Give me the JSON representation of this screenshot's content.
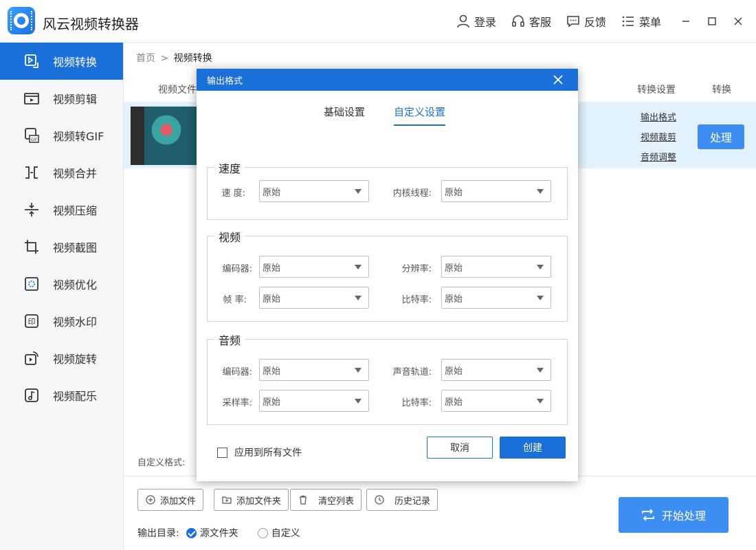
{
  "app": {
    "title": "风云视频转换器"
  },
  "header": {
    "login": "登录",
    "service": "客服",
    "feedback": "反馈",
    "menu": "菜单"
  },
  "sidebar": {
    "items": [
      {
        "label": "视频转换",
        "icon": "convert-icon"
      },
      {
        "label": "视频剪辑",
        "icon": "clip-icon"
      },
      {
        "label": "视频转GIF",
        "icon": "gif-icon"
      },
      {
        "label": "视频合并",
        "icon": "merge-icon"
      },
      {
        "label": "视频压缩",
        "icon": "compress-icon"
      },
      {
        "label": "视频截图",
        "icon": "screenshot-icon"
      },
      {
        "label": "视频优化",
        "icon": "optimize-icon"
      },
      {
        "label": "视频水印",
        "icon": "watermark-icon"
      },
      {
        "label": "视频旋转",
        "icon": "rotate-icon"
      },
      {
        "label": "视频配乐",
        "icon": "music-icon"
      }
    ]
  },
  "main": {
    "breadcrumb_home": "首页",
    "breadcrumb_sep": ">",
    "breadcrumb_current": "视频转换",
    "col_file": "视频文件",
    "col_settings": "转换设置",
    "col_convert": "转换",
    "row_links": [
      "输出格式",
      "视频裁剪",
      "音频调整"
    ],
    "process": "处理",
    "custom_format_label": "自定义格式:"
  },
  "bottom": {
    "add_file": "添加文件",
    "add_folder": "添加文件夹",
    "clear_list": "清空列表",
    "history": "历史记录",
    "output_dir_label": "输出目录:",
    "source_folder": "源文件夹",
    "custom": "自定义",
    "start": "开始处理"
  },
  "dialog": {
    "title": "输出格式",
    "tab_basic": "基础设置",
    "tab_custom": "自定义设置",
    "speed": {
      "title": "速度",
      "speed_label": "速 度:",
      "speed_value": "原始",
      "threads_label": "内核线程:",
      "threads_value": "原始"
    },
    "video": {
      "title": "视频",
      "codec_label": "编码器:",
      "codec_value": "原始",
      "resolution_label": "分辨率:",
      "resolution_value": "原始",
      "fps_label": "帧 率:",
      "fps_value": "原始",
      "bitrate_label": "比特率:",
      "bitrate_value": "原始"
    },
    "audio": {
      "title": "音频",
      "codec_label": "编码器:",
      "codec_value": "原始",
      "channel_label": "声音轨道:",
      "channel_value": "原始",
      "samplerate_label": "采样率:",
      "samplerate_value": "原始",
      "bitrate_label": "比特率:",
      "bitrate_value": "原始"
    },
    "apply_all": "应用到所有文件",
    "cancel": "取消",
    "create": "创建"
  },
  "colors": {
    "accent": "#1a6fd8",
    "button": "#3d8ef3",
    "row_highlight": "#e3f1fc"
  }
}
